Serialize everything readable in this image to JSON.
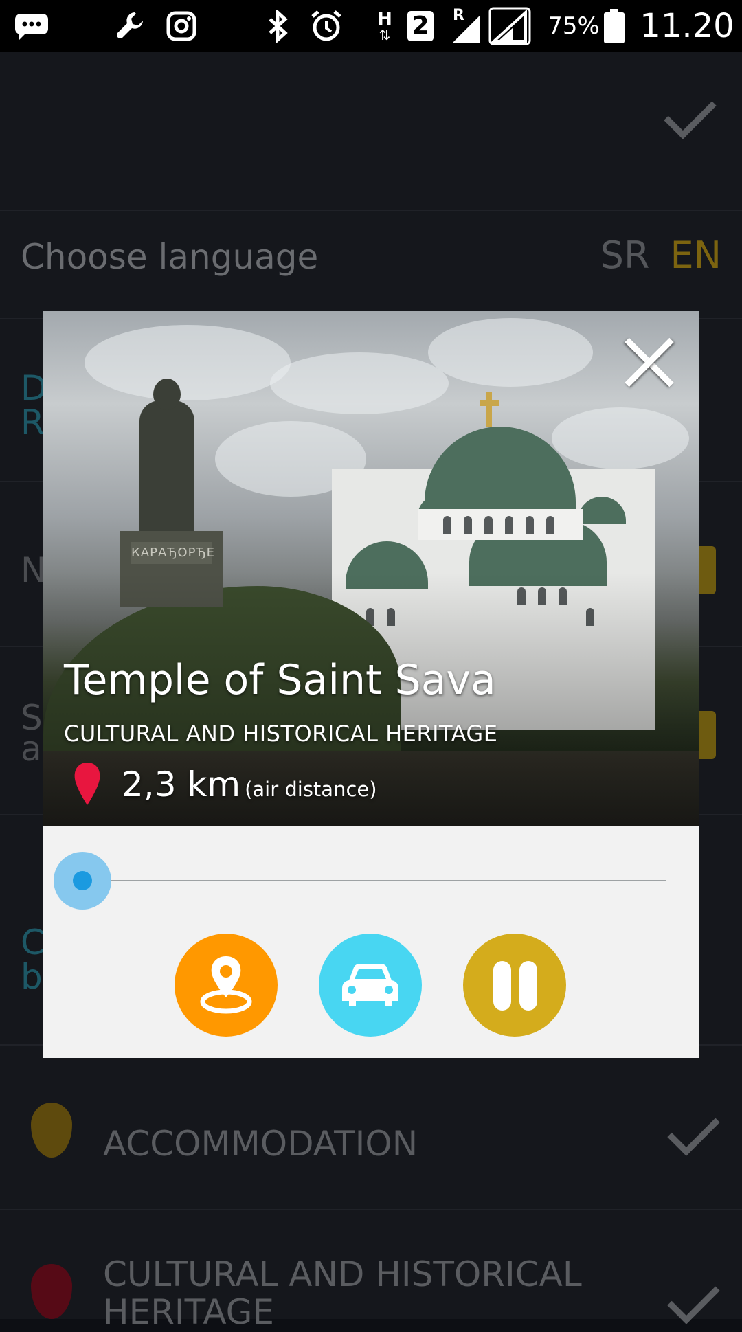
{
  "status_bar": {
    "battery_percent": "75%",
    "time": "11.20",
    "network_h": "H",
    "sim_badge": "2",
    "roaming": "R",
    "icons": [
      "chat-icon",
      "wrench-icon",
      "instagram-icon",
      "bluetooth-icon",
      "alarm-icon",
      "signal-icon",
      "battery-icon"
    ]
  },
  "background": {
    "choose_language_label": "Choose language",
    "lang_sr": "SR",
    "lang_en": "EN",
    "row_d": "D",
    "row_r": "R",
    "row_n": "N",
    "row_s": "S",
    "row_a": "a",
    "row_c": "C",
    "row_b": "b",
    "categories": [
      "ACCOMMODATION",
      "CULTURAL AND HISTORICAL",
      "HERITAGE"
    ]
  },
  "dialog": {
    "statue_plaque": "КАРАЂОРЂЕ",
    "title": "Temple of Saint Sava",
    "category": "CULTURAL AND HISTORICAL HERITAGE",
    "distance": "2,3 km",
    "distance_note": "(air distance)",
    "audio_progress": 0.0,
    "buttons": [
      "map-location-button",
      "car-directions-button",
      "pause-button"
    ],
    "colors": {
      "map": "#ff9800",
      "car": "#48d6f2",
      "pause": "#d4ac1c",
      "slider": "#1b9ae0"
    }
  }
}
